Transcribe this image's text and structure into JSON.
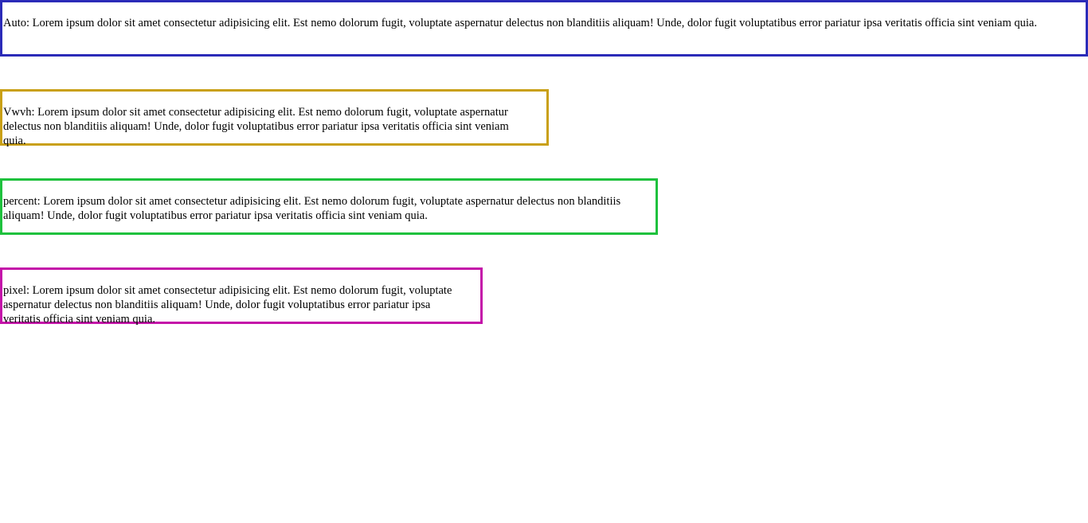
{
  "boxes": [
    {
      "id": "auto",
      "text": "Auto: Lorem ipsum dolor sit amet consectetur adipisicing elit. Est nemo dolorum fugit, voluptate aspernatur delectus non blanditiis aliquam! Unde, dolor fugit voluptatibus error pariatur ipsa veritatis officia sint veniam quia.",
      "border_color": "#2b2bb8"
    },
    {
      "id": "vwvh",
      "text": "Vwvh: Lorem ipsum dolor sit amet consectetur adipisicing elit. Est nemo dolorum fugit, voluptate aspernatur delectus non blanditiis aliquam! Unde, dolor fugit voluptatibus error pariatur ipsa veritatis officia sint veniam quia.",
      "border_color": "#c9a016"
    },
    {
      "id": "percent",
      "text": "percent: Lorem ipsum dolor sit amet consectetur adipisicing elit. Est nemo dolorum fugit, voluptate aspernatur delectus non blanditiis aliquam! Unde, dolor fugit voluptatibus error pariatur ipsa veritatis officia sint veniam quia.",
      "border_color": "#1ec13d"
    },
    {
      "id": "pixel",
      "text": "pixel: Lorem ipsum dolor sit amet consectetur adipisicing elit. Est nemo dolorum fugit, voluptate aspernatur delectus non blanditiis aliquam! Unde, dolor fugit voluptatibus error pariatur ipsa veritatis officia sint veniam quia.",
      "border_color": "#c414a9"
    }
  ]
}
